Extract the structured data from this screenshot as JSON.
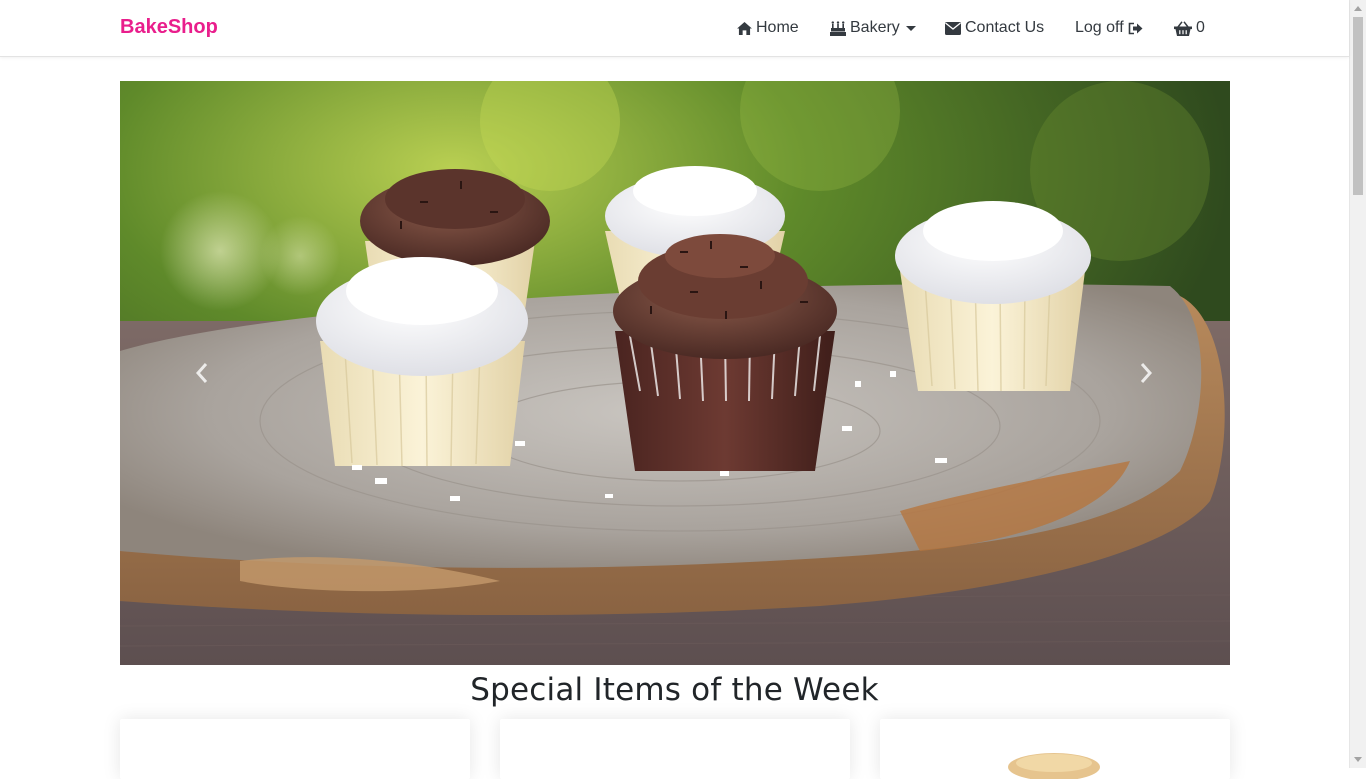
{
  "brand": {
    "name": "BakeShop",
    "color": "#e91e8c"
  },
  "nav": {
    "home": "Home",
    "bakery": "Bakery",
    "contact": "Contact Us",
    "logoff": "Log off",
    "cart_count": "0"
  },
  "icons": {
    "home": "home-icon",
    "bakery": "birthday-cake-icon",
    "contact": "envelope-icon",
    "logoff": "sign-out-icon",
    "cart": "shopping-basket-icon"
  },
  "carousel": {
    "image_subject": "cupcakes on wooden board"
  },
  "sections": {
    "specials_title": "Special Items of the Week"
  }
}
